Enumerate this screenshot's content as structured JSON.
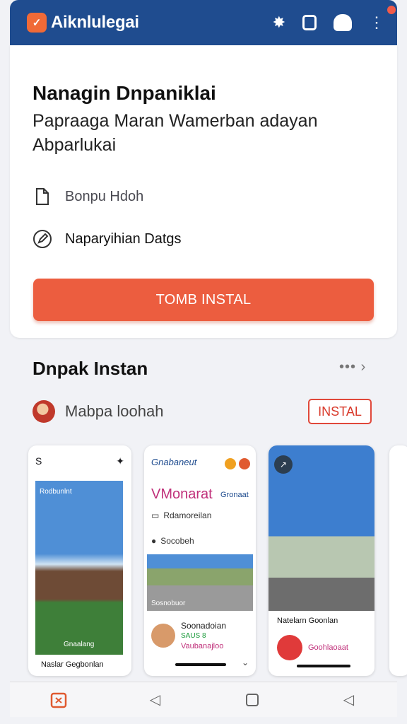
{
  "topbar": {
    "app_title": "Aiknlulegai",
    "logo_icon": "heart-check-icon",
    "icons": [
      "puzzle-icon",
      "square-icon",
      "robot-avatar-icon",
      "more-vert-icon"
    ],
    "accent": "#1f4c8f"
  },
  "main_card": {
    "title": "Nanagin Dnpaniklai",
    "description": "Papraaga Maran Wamerban adayan Abparlukai",
    "storage_label": "Bonpu Hdoh",
    "permission_label": "Naparyihian Datgs",
    "install_button": "TOMB INSTAL",
    "button_color": "#ec5d3f"
  },
  "instant_section": {
    "title": "Dnpak Instan",
    "more": "•••",
    "app_name": "Mabpa loohah",
    "install_label": "INSTAL"
  },
  "screenshots": [
    {
      "head_left": "S",
      "scene_label": "Rodbunlnt",
      "person_label": "Gnaalang",
      "caption": "Naslar Gegbonlan"
    },
    {
      "brand": "Gnabaneut",
      "big_text": "VMonarat",
      "small_text": "Gronaat",
      "line1": "Rdamoreilan",
      "line2": "Socobeh",
      "scene_label": "Sosnobuor",
      "card_title": "Soonadoian",
      "card_sub": "SAUS 8",
      "card_pink": "Vaubanajloo",
      "chevron": "⌄"
    },
    {
      "caption": "Natelarn Goonlan",
      "pink_text": "Goohlaoaat"
    }
  ],
  "navbar": {
    "icons": [
      "puzzle-nav-icon",
      "back-icon",
      "home-icon",
      "recents-icon"
    ]
  }
}
